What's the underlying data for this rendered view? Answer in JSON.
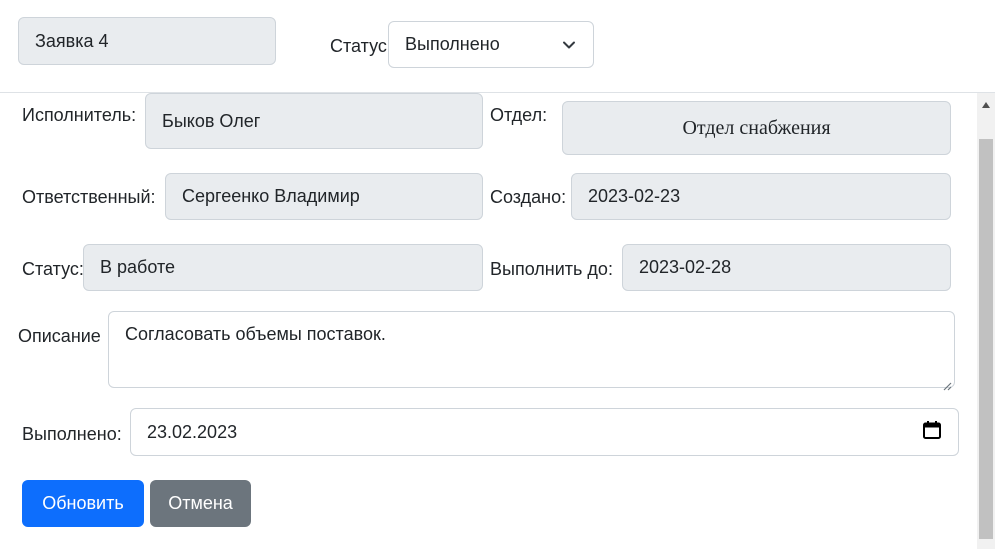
{
  "header": {
    "request_title": "Заявка 4",
    "status_label": "Статус",
    "status_value": "Выполнено"
  },
  "form": {
    "executor_label": "Исполнитель:",
    "executor_value": "Быков Олег",
    "department_label": "Отдел:",
    "department_value": "Отдел снабжения",
    "responsible_label": "Ответственный:",
    "responsible_value": "Сергеенко Владимир",
    "created_label": "Создано:",
    "created_value": "2023-02-23",
    "status_label": "Статус:",
    "status_value": "В работе",
    "due_label": "Выполнить до:",
    "due_value": "2023-02-28",
    "description_label": "Описание",
    "description_value": "Согласовать объемы поставок.",
    "completed_label": "Выполнено:",
    "completed_value": "23.02.2023"
  },
  "buttons": {
    "update_label": "Обновить",
    "cancel_label": "Отмена"
  },
  "icons": {
    "status_select": "chevron-down-icon",
    "date_picker": "calendar-icon",
    "scroll_up": "arrow-up-icon",
    "textarea_grip": "resize-grip-icon"
  },
  "colors": {
    "primary": "#0d6efd",
    "secondary": "#6c757d",
    "readonly_bg": "#e9ecef"
  }
}
